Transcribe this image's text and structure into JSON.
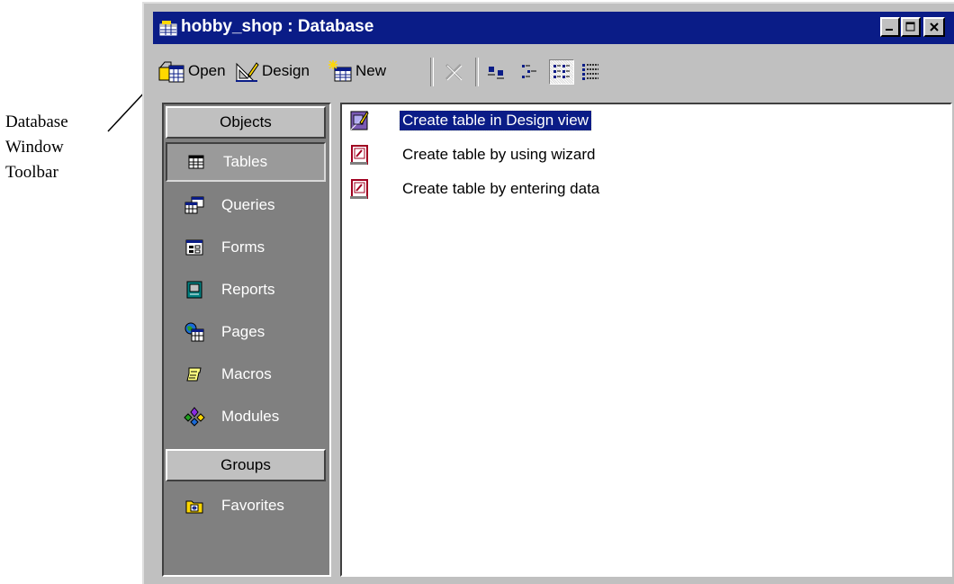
{
  "annotation": {
    "lines": [
      "Database",
      "Window",
      "Toolbar"
    ]
  },
  "window": {
    "title": "hobby_shop : Database",
    "buttons": [
      "minimize",
      "maximize",
      "close"
    ]
  },
  "toolbar": {
    "open_label": "Open",
    "design_label": "Design",
    "new_label": "New"
  },
  "objects_bar": {
    "objects_header": "Objects",
    "items": [
      {
        "label": "Tables",
        "icon": "table-icon",
        "selected": true
      },
      {
        "label": "Queries",
        "icon": "query-icon"
      },
      {
        "label": "Forms",
        "icon": "form-icon"
      },
      {
        "label": "Reports",
        "icon": "report-icon"
      },
      {
        "label": "Pages",
        "icon": "page-icon"
      },
      {
        "label": "Macros",
        "icon": "macro-icon"
      },
      {
        "label": "Modules",
        "icon": "module-icon"
      }
    ],
    "groups_header": "Groups",
    "groups": [
      {
        "label": "Favorites",
        "icon": "favorites-folder-icon"
      }
    ]
  },
  "list": {
    "items": [
      {
        "label": "Create table in Design view",
        "icon": "design-view-icon",
        "selected": true
      },
      {
        "label": "Create table by using wizard",
        "icon": "wizard-icon"
      },
      {
        "label": "Create table by entering data",
        "icon": "datasheet-icon"
      }
    ]
  },
  "colors": {
    "title_bar": "#0a1c87",
    "selection": "#0a1c87",
    "objects_bg": "#808080",
    "window_face": "#c0c0c0"
  }
}
